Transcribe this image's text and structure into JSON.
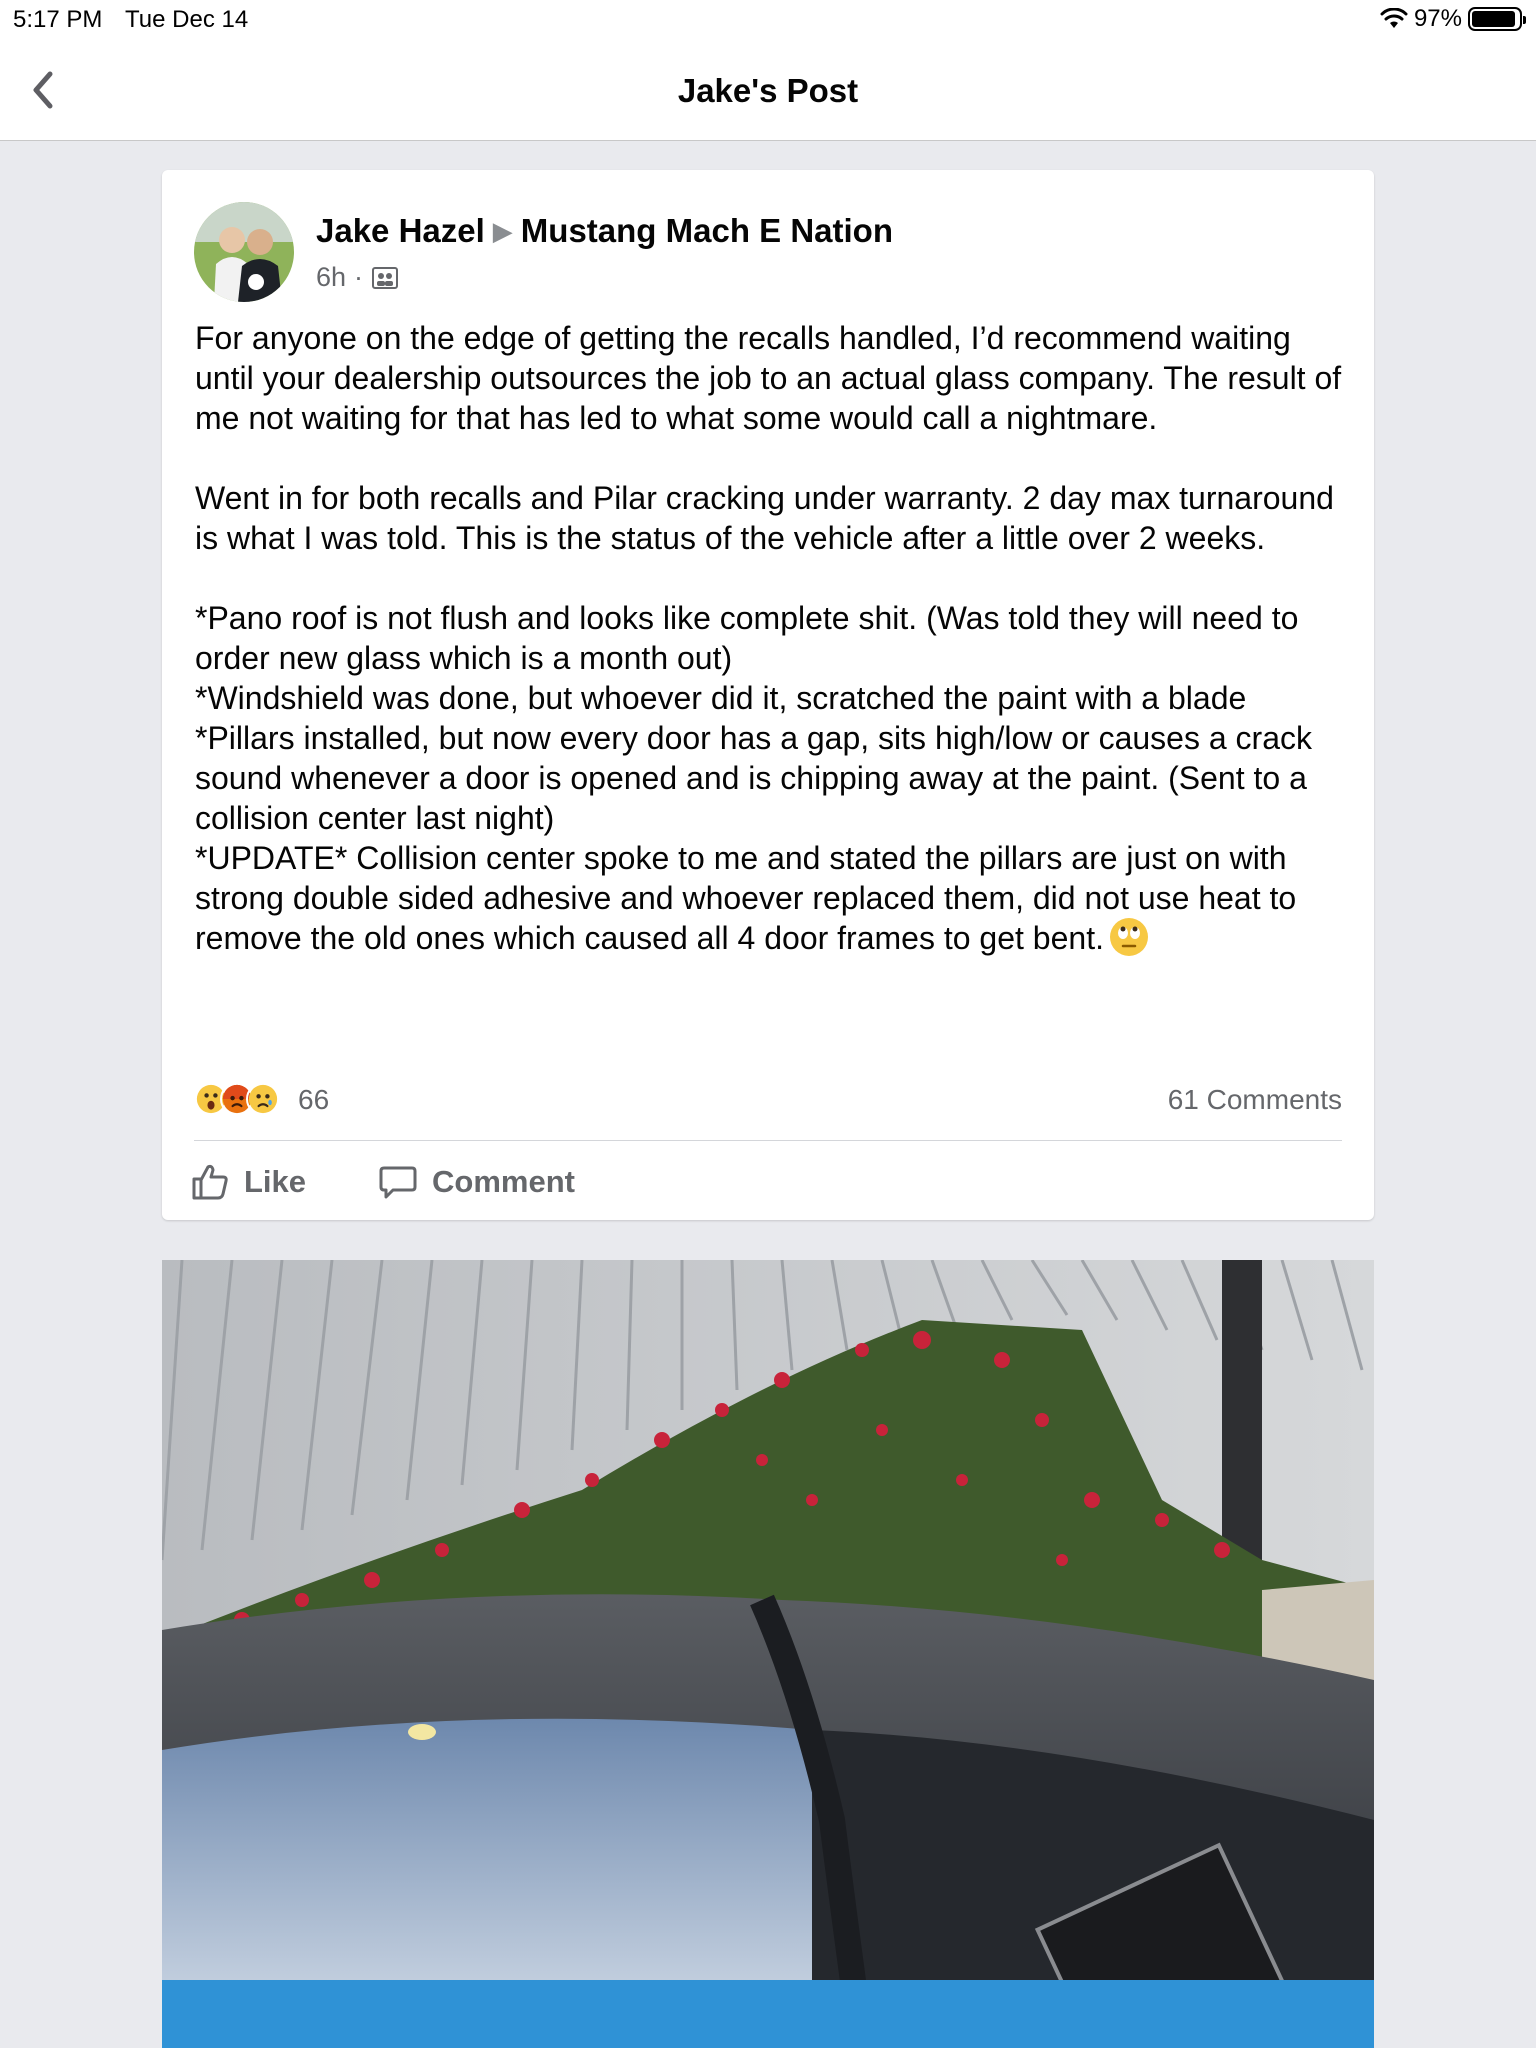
{
  "status_bar": {
    "time": "5:17 PM",
    "date": "Tue Dec 14",
    "battery_text": "97%",
    "battery_level": 0.97
  },
  "nav": {
    "title": "Jake's Post",
    "back_icon": "chevron-left-icon"
  },
  "post": {
    "author": "Jake Hazel",
    "group": "Mustang Mach E Nation",
    "time_ago": "6h",
    "separator": "·",
    "audience_icon": "group-icon",
    "paragraphs": [
      "For anyone on the edge of getting the recalls handled, I’d recommend waiting until your dealership outsources the job to an actual glass company. The result of me not waiting for that has led to what some would call a nightmare.",
      "Went in for both recalls and Pilar cracking under warranty. 2 day max turnaround is what I was told. This is the status of the vehicle after a little over 2 weeks.",
      "*Pano roof is not flush and looks like complete shit. (Was told they will need to order new glass which is a month out)\n*Windshield was done, but whoever did it, scratched the paint with a blade\n*Pillars installed, but now every door has a gap, sits high/low or causes a crack sound whenever a door is opened and is chipping away at the paint. (Sent to a collision center last night)\n*UPDATE* Collision center spoke to me and stated the pillars are just on with strong double sided adhesive and whoever replaced them, did not use heat to remove the old ones which caused all 4 door frames to get bent."
    ],
    "reaction_icons": [
      "wow-reaction-icon",
      "angry-reaction-icon",
      "sad-reaction-icon"
    ],
    "reaction_count": "66",
    "comments_count": "61 Comments",
    "like_label": "Like",
    "comment_label": "Comment",
    "colors": {
      "secondary_text": "#65676b",
      "background": "#e9eaee"
    }
  }
}
